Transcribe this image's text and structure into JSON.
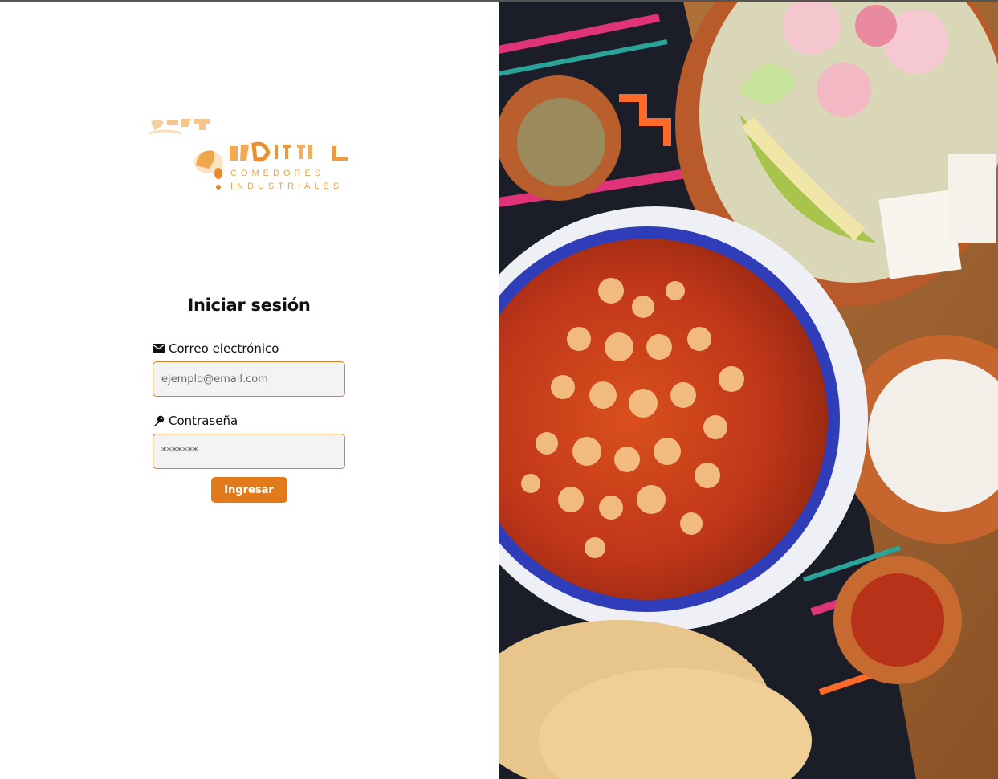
{
  "brand": {
    "logo_line1": "COMEDORES",
    "logo_line2": "INDUSTRIALES",
    "accent_color": "#e07a1a"
  },
  "login": {
    "title": "Iniciar sesión",
    "email_label": "Correo electrónico",
    "email_icon": "envelope-icon",
    "email_placeholder": "ejemplo@email.com",
    "password_label": "Contraseña",
    "password_icon": "key-icon",
    "password_value": "*******",
    "submit_label": "Ingresar"
  },
  "hero_image": {
    "description_icon": "food-photo",
    "dominant_colors": [
      "#c8421a",
      "#e8934a",
      "#2a3a9a",
      "#f4efe6"
    ]
  }
}
